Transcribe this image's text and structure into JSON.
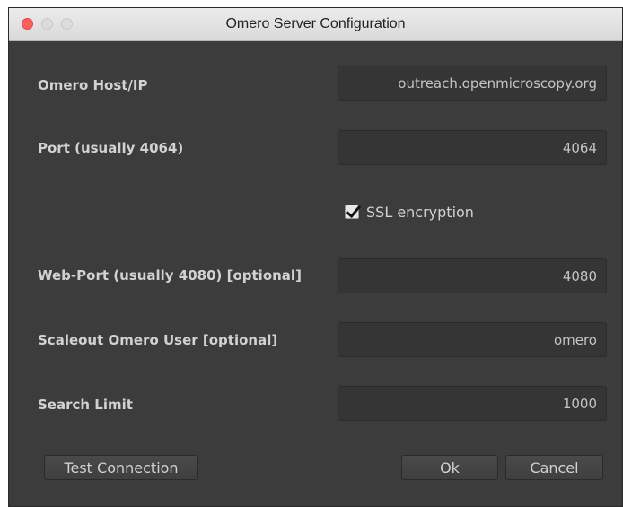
{
  "window": {
    "title": "Omero Server Configuration"
  },
  "fields": {
    "host": {
      "label": "Omero Host/IP",
      "value": "outreach.openmicroscopy.org"
    },
    "port": {
      "label": "Port (usually 4064)",
      "value": "4064"
    },
    "webport": {
      "label": "Web-Port (usually 4080) [optional]",
      "value": "4080"
    },
    "user": {
      "label": "Scaleout Omero User [optional]",
      "value": "omero"
    },
    "limit": {
      "label": "Search Limit",
      "value": "1000"
    }
  },
  "ssl": {
    "label": "SSL encryption",
    "checked": true
  },
  "buttons": {
    "test": "Test Connection",
    "ok": "Ok",
    "cancel": "Cancel"
  },
  "colors": {
    "window_bg": "#3c3c3c",
    "field_bg": "#353535",
    "text": "#d2d2d2",
    "close": "#fc605c"
  }
}
